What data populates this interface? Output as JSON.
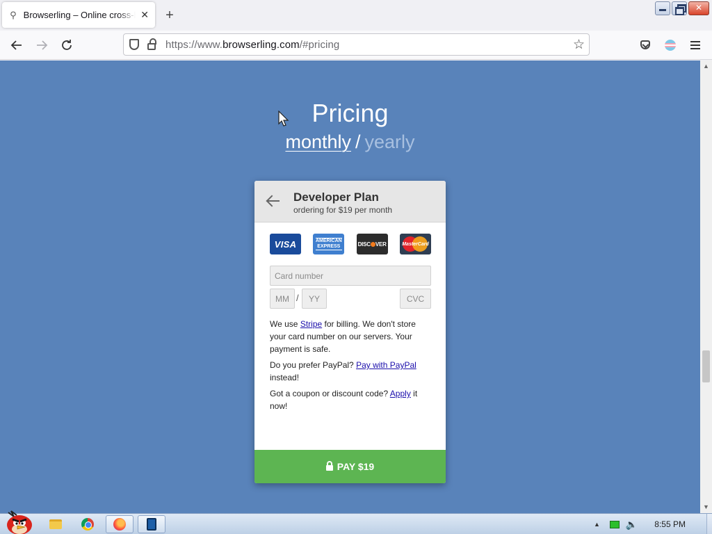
{
  "browser": {
    "tab": {
      "title": "Browserling – Online cross-browser testing",
      "close": "✕"
    },
    "new_tab": "+",
    "url": {
      "prefix": "https://www.",
      "domain": "browserling.com",
      "suffix": "/#pricing"
    }
  },
  "page": {
    "heading": "Pricing",
    "period": {
      "monthly": "monthly",
      "separator": "/",
      "yearly": "yearly"
    },
    "checkout": {
      "plan_name": "Developer Plan",
      "plan_sub": "ordering for $19 per month",
      "card_brands": {
        "visa": "VISA",
        "amex_top": "AMERICAN",
        "amex_bottom": "EXPRESS",
        "discover_left": "DISC",
        "discover_right": "VER",
        "mastercard": "MasterCard"
      },
      "fields": {
        "card_number_placeholder": "Card number",
        "month_placeholder": "MM",
        "slash": "/",
        "year_placeholder": "YY",
        "cvc_placeholder": "CVC"
      },
      "notice_1_pre": "We use ",
      "notice_1_link": "Stripe",
      "notice_1_post": " for billing. We don't store your card number on our servers. Your payment is safe.",
      "notice_2_pre": "Do you prefer PayPal? ",
      "notice_2_link": "Pay with PayPal",
      "notice_2_post": " instead!",
      "notice_3_pre": "Got a coupon or discount code? ",
      "notice_3_link": "Apply",
      "notice_3_post": " it now!",
      "pay_button": "PAY $19"
    }
  },
  "taskbar": {
    "clock": "8:55 PM"
  },
  "colors": {
    "page_background": "#5983ba",
    "pay_button": "#5db552",
    "link": "#1a0dab"
  }
}
